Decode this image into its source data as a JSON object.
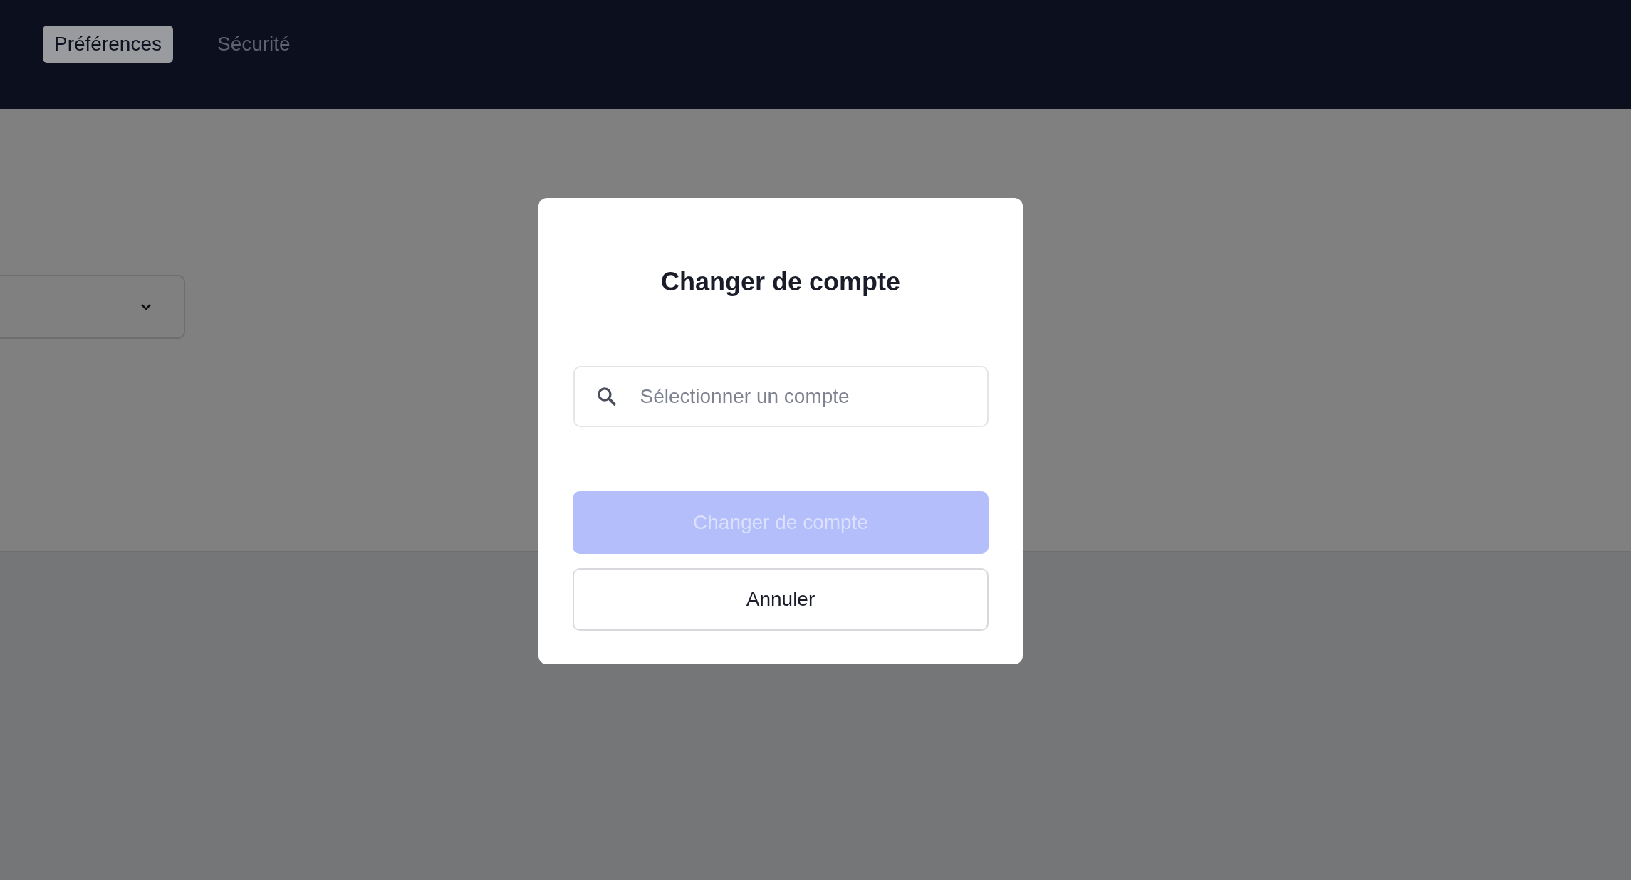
{
  "tabs": [
    {
      "label": "Préférences",
      "selected": true
    },
    {
      "label": "Sécurité",
      "selected": false
    }
  ],
  "dialog": {
    "title": "Changer de compte",
    "search": {
      "placeholder": "Sélectionner un compte"
    },
    "buttons": [
      {
        "label": "Changer de compte",
        "kind": "primary",
        "disabled": true
      },
      {
        "label": "Annuler",
        "kind": "secondary",
        "disabled": false
      }
    ]
  }
}
